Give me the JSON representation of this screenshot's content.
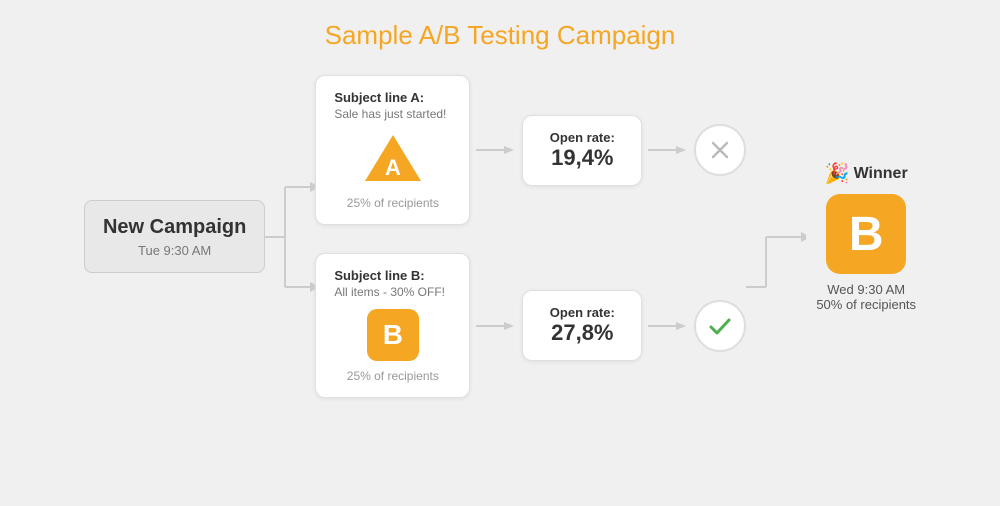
{
  "page": {
    "title": "Sample A/B Testing Campaign",
    "title_color": "#f5a623"
  },
  "campaign_start": {
    "label": "New Campaign",
    "sublabel": "Tue 9:30 AM"
  },
  "branch_a": {
    "subject_title": "Subject line A:",
    "subject_subtitle": "Sale has just started!",
    "icon_letter": "A",
    "recipients": "25% of recipients",
    "open_rate_label": "Open rate:",
    "open_rate_value": "19,4%",
    "result": "reject"
  },
  "branch_b": {
    "subject_title": "Subject line B:",
    "subject_subtitle": "All items - 30% OFF!",
    "icon_letter": "B",
    "recipients": "25% of recipients",
    "open_rate_label": "Open rate:",
    "open_rate_value": "27,8%",
    "result": "accept"
  },
  "winner": {
    "label": "Winner",
    "icon": "🎉",
    "letter": "B",
    "time": "Wed 9:30 AM",
    "recipients": "50% of recipients"
  }
}
